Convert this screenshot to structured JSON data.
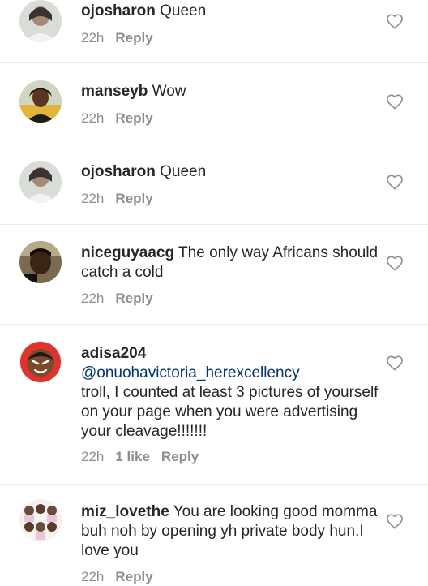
{
  "comments": [
    {
      "username": "ojosharon",
      "text": " Queen",
      "mention": "",
      "time": "22h",
      "likes": "",
      "reply": "Reply",
      "avatar_icon": "profile-photo-woman"
    },
    {
      "username": "manseyb",
      "text": " Wow",
      "mention": "",
      "time": "22h",
      "likes": "",
      "reply": "Reply",
      "avatar_icon": "profile-photo-woman-outdoor"
    },
    {
      "username": "ojosharon",
      "text": " Queen",
      "mention": "",
      "time": "22h",
      "likes": "",
      "reply": "Reply",
      "avatar_icon": "profile-photo-woman"
    },
    {
      "username": "niceguyaacg",
      "text": " The only way Africans should catch a cold",
      "mention": "",
      "time": "22h",
      "likes": "",
      "reply": "Reply",
      "avatar_icon": "profile-photo-man-selfie"
    },
    {
      "username": "adisa204",
      "text": "troll, I counted at least 3 pictures of yourself on your page when you were advertising your cleavage!!!!!!!",
      "mention": "@onuohavictoria_herexcellency",
      "time": "22h",
      "likes": "1 like",
      "reply": "Reply",
      "avatar_icon": "cartoon-face-avatar"
    },
    {
      "username": "miz_lovethe",
      "text": " You are looking good momma buh noh by opening yh private body hun.I love you",
      "mention": "",
      "time": "22h",
      "likes": "",
      "reply": "Reply",
      "avatar_icon": "profile-photo-group-collage"
    }
  ],
  "colors": {
    "text": "#262626",
    "meta": "#8e8e8e",
    "mention": "#003569",
    "divider": "#ececec"
  }
}
